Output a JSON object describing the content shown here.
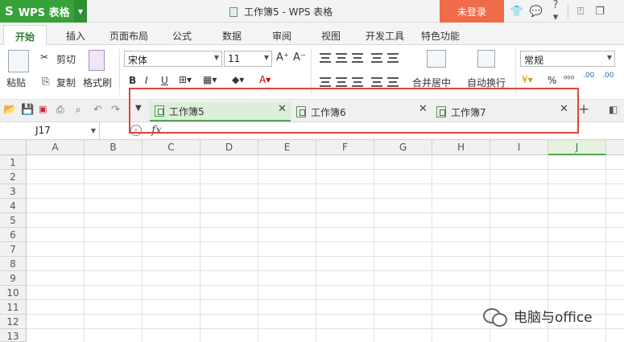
{
  "titlebar": {
    "app_name": "WPS 表格",
    "doc_title": "工作簿5 - WPS 表格",
    "login_label": "未登录",
    "icons": [
      "shirt-icon",
      "chat-icon",
      "help-icon",
      "minimize-icon",
      "restore-icon"
    ],
    "help_label": "?",
    "accent_color": "#36a23a",
    "login_color": "#f06b4a"
  },
  "menu": {
    "tabs": [
      "开始",
      "插入",
      "页面布局",
      "公式",
      "数据",
      "审阅",
      "视图",
      "开发工具",
      "特色功能"
    ],
    "active_tab": "开始"
  },
  "ribbon": {
    "paste_label": "粘贴",
    "cut_label": "剪切",
    "copy_label": "复制",
    "format_painter_label": "格式刷",
    "font_name": "宋体",
    "font_size": "11",
    "font_grow": "A⁺",
    "font_shrink": "A⁻",
    "bold": "B",
    "italic": "I",
    "underline": "U",
    "merge_label": "合并居中",
    "wrap_label": "自动换行",
    "number_format": "常规",
    "percent": "%",
    "decimal_inc": ".00",
    "decimal_dec": ".00"
  },
  "doc_tabs": [
    {
      "label": "工作簿5",
      "active": true
    },
    {
      "label": "工作簿6",
      "active": false
    },
    {
      "label": "工作簿7",
      "active": false
    }
  ],
  "formula_bar": {
    "cell_ref": "J17",
    "fx_label": "fx"
  },
  "grid": {
    "columns": [
      "A",
      "B",
      "C",
      "D",
      "E",
      "F",
      "G",
      "H",
      "I",
      "J"
    ],
    "active_column": "J",
    "rows": [
      "1",
      "2",
      "3",
      "4",
      "5",
      "6",
      "7",
      "8",
      "9",
      "10",
      "11",
      "12",
      "13"
    ]
  },
  "highlight_color": "#e0443a",
  "watermark": "电脑与office"
}
